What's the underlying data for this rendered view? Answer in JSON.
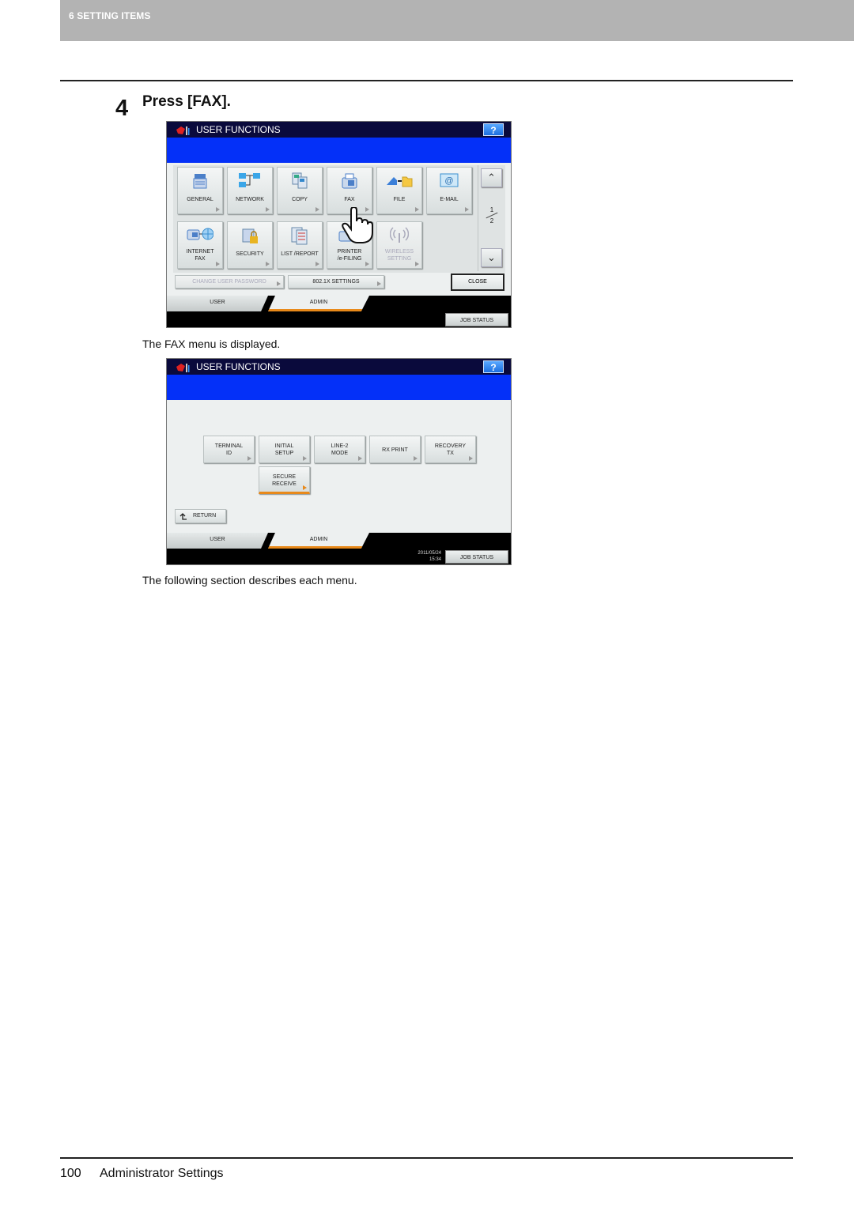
{
  "header": {
    "section_label": "6 SETTING ITEMS"
  },
  "step": {
    "number": "4",
    "title": "Press [FAX]."
  },
  "screen1": {
    "title": "USER FUNCTIONS",
    "help_label": "?",
    "row1": [
      {
        "label": "GENERAL",
        "icon": "copier-icon"
      },
      {
        "label": "NETWORK",
        "icon": "network-icon"
      },
      {
        "label": "COPY",
        "icon": "copy-icon"
      },
      {
        "label": "FAX",
        "icon": "fax-icon"
      },
      {
        "label": "FILE",
        "icon": "file-folder-icon"
      },
      {
        "label": "E-MAIL",
        "icon": "email-icon"
      }
    ],
    "row2": [
      {
        "label1": "INTERNET",
        "label2": "FAX",
        "icon": "internet-fax-icon"
      },
      {
        "label1": "SECURITY",
        "label2": "",
        "icon": "security-lock-icon"
      },
      {
        "label1": "LIST /REPORT",
        "label2": "",
        "icon": "list-report-icon"
      },
      {
        "label1": "PRINTER",
        "label2": "/e-FILING",
        "icon": "printer-icon"
      },
      {
        "label1": "WIRELESS",
        "label2": "SETTING",
        "icon": "wireless-icon",
        "disabled": true
      }
    ],
    "page_current": "1",
    "page_total": "2",
    "change_password_label": "CHANGE USER PASSWORD",
    "settings_8021x_label": "802.1X SETTINGS",
    "close_label": "CLOSE",
    "tabs": {
      "user": "USER",
      "admin": "ADMIN"
    },
    "job_status_label": "JOB STATUS"
  },
  "caption1": "The FAX menu is displayed.",
  "screen2": {
    "title": "USER FUNCTIONS",
    "help_label": "?",
    "buttons": [
      {
        "l1": "TERMINAL",
        "l2": "ID"
      },
      {
        "l1": "INITIAL",
        "l2": "SETUP"
      },
      {
        "l1": "LINE-2",
        "l2": "MODE"
      },
      {
        "l1": "RX PRINT",
        "l2": ""
      },
      {
        "l1": "RECOVERY",
        "l2": "TX"
      },
      {
        "l1": "SECURE",
        "l2": "RECEIVE"
      }
    ],
    "return_label": "RETURN",
    "tabs": {
      "user": "USER",
      "admin": "ADMIN"
    },
    "date": "2011/05/24",
    "time": "15:34",
    "job_status_label": "JOB STATUS"
  },
  "caption2": "The following section describes each menu.",
  "footer": {
    "page_number": "100",
    "title": "Administrator Settings"
  },
  "colors": {
    "title_bar": "#0a0a3c",
    "blue_band": "#0430f8",
    "tab_accent": "#e8891a",
    "header_band": "#b3b3b3"
  }
}
